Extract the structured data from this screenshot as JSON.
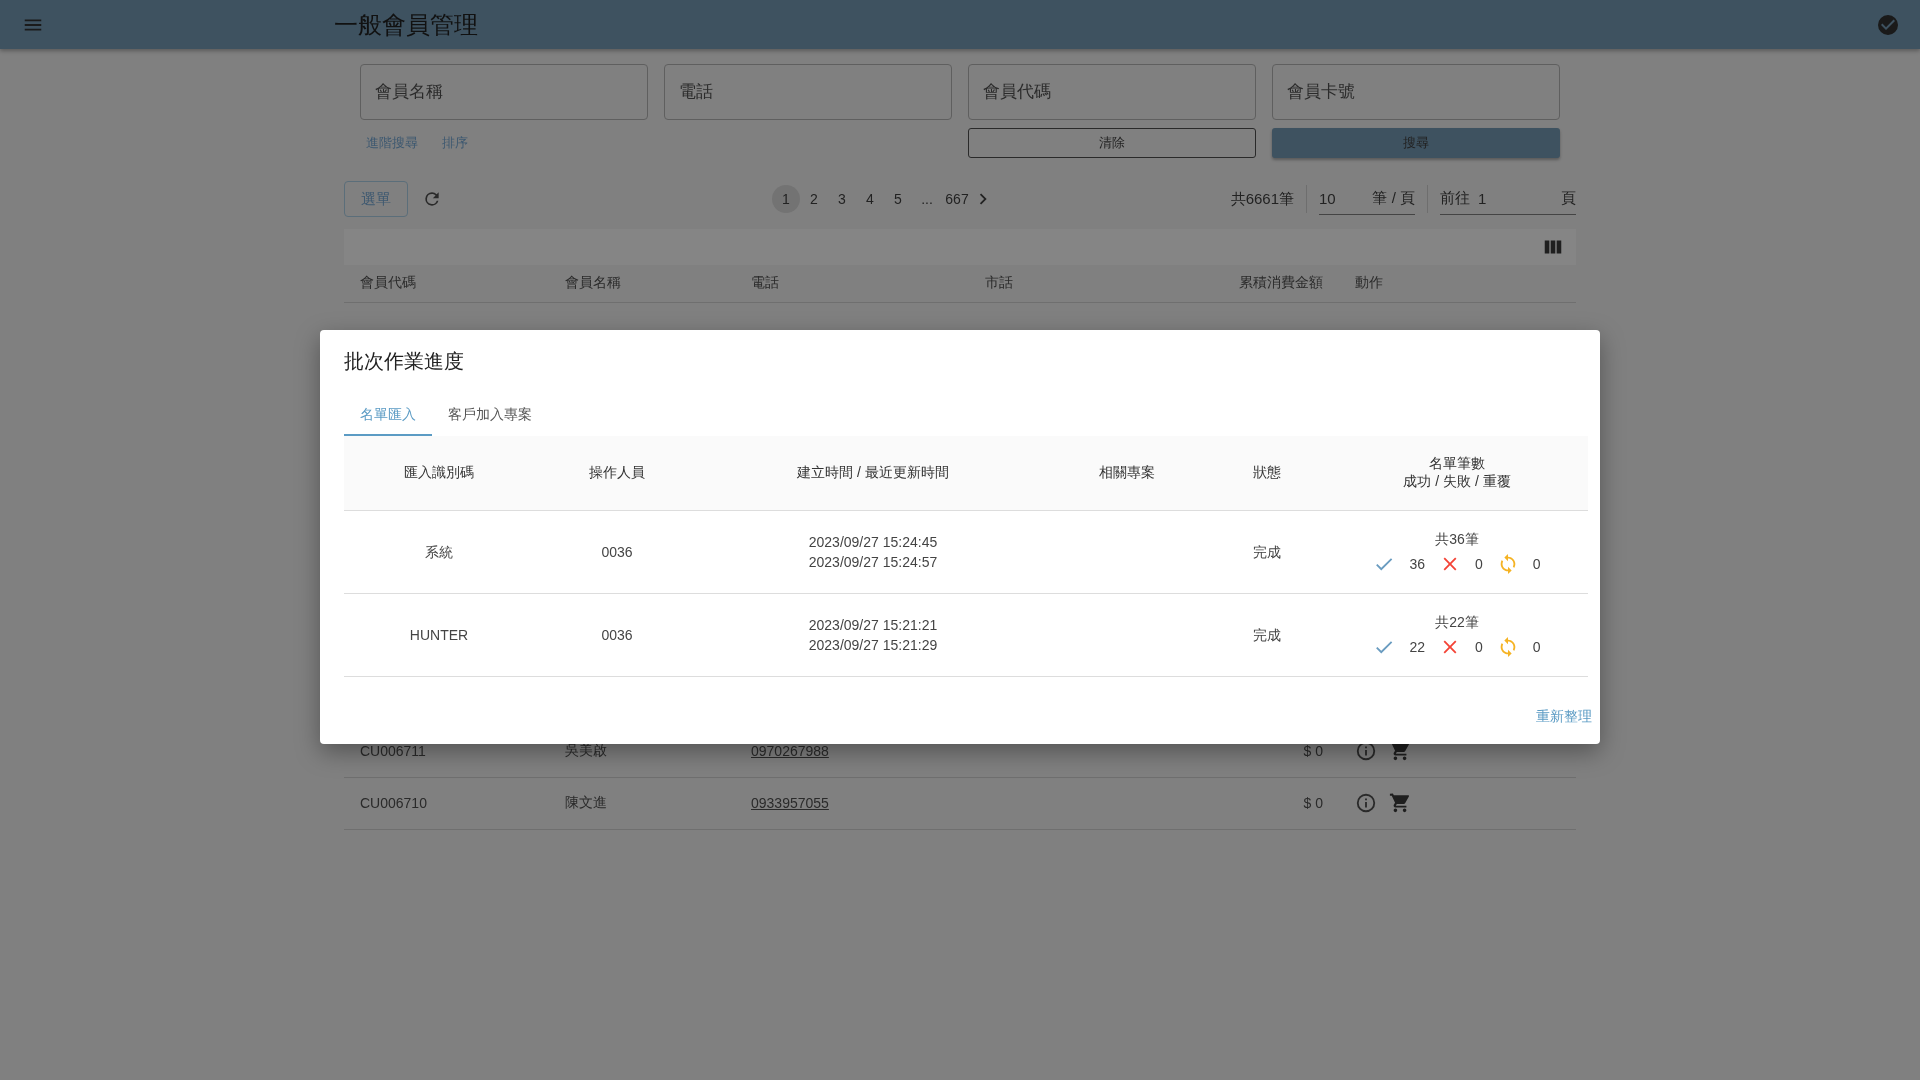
{
  "app_bar": {
    "title": "一般會員管理"
  },
  "search": {
    "fields": [
      {
        "placeholder": "會員名稱"
      },
      {
        "placeholder": "電話"
      },
      {
        "placeholder": "會員代碼"
      },
      {
        "placeholder": "會員卡號"
      }
    ],
    "links": [
      "進階搜尋",
      "排序"
    ],
    "buttons": [
      {
        "label": "清除",
        "kind": "outlined"
      },
      {
        "label": "搜尋",
        "kind": "filled"
      }
    ]
  },
  "toolbar": {
    "menu_button": "選單",
    "pages": [
      {
        "label": "1",
        "selected": true
      },
      {
        "label": "2",
        "selected": false
      },
      {
        "label": "3",
        "selected": false
      },
      {
        "label": "4",
        "selected": false
      },
      {
        "label": "5",
        "selected": false
      },
      {
        "label": "...",
        "selected": false
      },
      {
        "label": "667",
        "selected": false
      }
    ],
    "total": "共6661筆",
    "per_page": {
      "value": "10",
      "unit": "筆 / 頁"
    },
    "goto": {
      "prefix": "前往",
      "value": "1",
      "suffix": "頁"
    }
  },
  "member_table": {
    "columns": [
      "會員代碼",
      "會員名稱",
      "電話",
      "市話",
      "累積消費金額",
      "動作"
    ],
    "rows": [
      {
        "code": "CU006711",
        "name": "吳美啟",
        "phone": "0970267988",
        "amount": "$ 0"
      },
      {
        "code": "CU006710",
        "name": "陳文進",
        "phone": "0933957055",
        "amount": "$ 0"
      }
    ]
  },
  "dialog": {
    "title": "批次作業進度",
    "tabs": [
      {
        "label": "名單匯入",
        "selected": true
      },
      {
        "label": "客戶加入專案",
        "selected": false
      }
    ],
    "columns": [
      {
        "label": "匯入識別碼"
      },
      {
        "label": "操作人員"
      },
      {
        "label": "建立時間 / 最近更新時間"
      },
      {
        "label": "相關專案"
      },
      {
        "label": "狀態"
      },
      {
        "label": "名單筆數",
        "sublabel": "成功 / 失敗 / 重覆"
      }
    ],
    "rows": [
      {
        "id": "系統",
        "operator": "0036",
        "created": "2023/09/27 15:24:45",
        "updated": "2023/09/27 15:24:57",
        "status": "完成",
        "total": "共36筆",
        "success": "36",
        "failed": "0",
        "duplicate": "0"
      },
      {
        "id": "HUNTER",
        "operator": "0036",
        "created": "2023/09/27 15:21:21",
        "updated": "2023/09/27 15:21:29",
        "status": "完成",
        "total": "共22筆",
        "success": "22",
        "failed": "0",
        "duplicate": "0"
      }
    ],
    "refresh_link": "重新整理"
  }
}
